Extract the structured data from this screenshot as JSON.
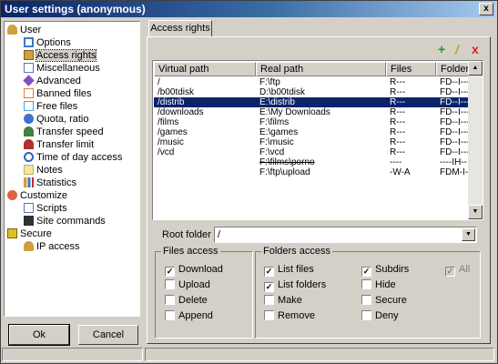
{
  "window": {
    "title": "User settings (anonymous)",
    "close_label": "x"
  },
  "tree": {
    "items": [
      {
        "label": "User",
        "icon": "user-icon",
        "color": "#d0a040"
      },
      {
        "label": "Options",
        "icon": "options-icon",
        "color": "#3c78c8"
      },
      {
        "label": "Access rights",
        "icon": "access-rights-icon",
        "color": "#d0a040"
      },
      {
        "label": "Miscellaneous",
        "icon": "miscellaneous-icon",
        "color": "#6070c0"
      },
      {
        "label": "Advanced",
        "icon": "advanced-icon",
        "color": "#8050c0"
      },
      {
        "label": "Banned files",
        "icon": "banned-files-icon",
        "color": "#e08030"
      },
      {
        "label": "Free files",
        "icon": "free-files-icon",
        "color": "#50a0e0"
      },
      {
        "label": "Quota, ratio",
        "icon": "quota-icon",
        "color": "#4070d0"
      },
      {
        "label": "Transfer speed",
        "icon": "transfer-speed-icon",
        "color": "#408040"
      },
      {
        "label": "Transfer limit",
        "icon": "transfer-limit-icon",
        "color": "#b03030"
      },
      {
        "label": "Time of day access",
        "icon": "clock-icon",
        "color": "#3060c0"
      },
      {
        "label": "Notes",
        "icon": "notes-icon",
        "color": "#c0b060"
      },
      {
        "label": "Statistics",
        "icon": "statistics-icon",
        "color": "#d0a040"
      },
      {
        "label": "Customize",
        "icon": "customize-icon",
        "color": "#e06040"
      },
      {
        "label": "Scripts",
        "icon": "scripts-icon",
        "color": "#6070c0"
      },
      {
        "label": "Site commands",
        "icon": "site-commands-icon",
        "color": "#303030"
      },
      {
        "label": "Secure",
        "icon": "secure-icon",
        "color": "#e0c020"
      },
      {
        "label": "IP access",
        "icon": "ip-access-icon",
        "color": "#d0a040"
      }
    ]
  },
  "buttons": {
    "ok": "Ok",
    "cancel": "Cancel"
  },
  "tabs": {
    "active": "Access rights"
  },
  "toolbar": {
    "add": "+",
    "edit": "/",
    "delete": "x"
  },
  "table": {
    "headers": [
      "Virtual path",
      "Real path",
      "Files",
      "Folders"
    ],
    "rows": [
      [
        "/",
        "F:\\ftp",
        "R---",
        "FD--I---"
      ],
      [
        "/b00tdisk",
        "D:\\b00tdisk",
        "R---",
        "FD--I---"
      ],
      [
        "/distrib",
        "E:\\distrib",
        "R---",
        "FD--I---"
      ],
      [
        "/downloads",
        "E:\\My Downloads",
        "R---",
        "FD--I---"
      ],
      [
        "/films",
        "F:\\films",
        "R---",
        "FD--I---"
      ],
      [
        "/games",
        "E:\\games",
        "R---",
        "FD--I---"
      ],
      [
        "/music",
        "F:\\music",
        "R---",
        "FD--I---"
      ],
      [
        "/vcd",
        "F:\\vcd",
        "R---",
        "FD--I---"
      ],
      [
        "",
        "F:\\films\\porno",
        "----",
        "----IH--"
      ],
      [
        "",
        "F:\\ftp\\upload",
        "-W-A",
        "FDM-I---"
      ]
    ]
  },
  "root_folder": {
    "label": "Root folder",
    "value": "/"
  },
  "files_access": {
    "title": "Files access",
    "items": [
      "Download",
      "Upload",
      "Delete",
      "Append"
    ]
  },
  "folders_access": {
    "title": "Folders access",
    "items": [
      "List files",
      "List folders",
      "Make",
      "Remove",
      "Subdirs",
      "Hide",
      "Secure",
      "Deny"
    ],
    "all_label": "All"
  },
  "check_mark": "✓"
}
